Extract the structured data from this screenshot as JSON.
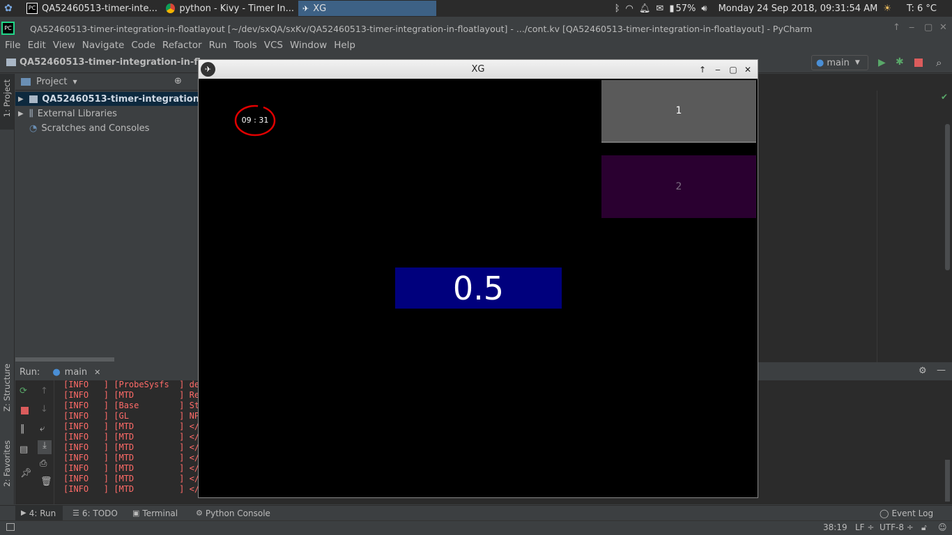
{
  "taskbar": {
    "tasks": [
      {
        "label": "QA52460513-timer-inte..."
      },
      {
        "label": "python - Kivy - Timer In..."
      },
      {
        "label": "XG"
      }
    ],
    "battery": "57%",
    "datetime": "Monday 24 Sep 2018, 09:31:54 AM",
    "weather": "T: 6 °C"
  },
  "ide": {
    "title": "QA52460513-timer-integration-in-floatlayout [~/dev/sxQA/sxKv/QA52460513-timer-integration-in-floatlayout] - .../cont.kv [QA52460513-timer-integration-in-floatlayout] - PyCharm",
    "menu": [
      "File",
      "Edit",
      "View",
      "Navigate",
      "Code",
      "Refactor",
      "Run",
      "Tools",
      "VCS",
      "Window",
      "Help"
    ],
    "breadcrumb": "QA52460513-timer-integration-in-fl",
    "run_config": "main",
    "left_tabs": {
      "project": "1: Project",
      "structure": "Z: Structure",
      "favorites": "2: Favorites"
    },
    "project_panel": {
      "header": "Project",
      "items": [
        {
          "label": "QA52460513-timer-integration"
        },
        {
          "label": "External Libraries"
        },
        {
          "label": "Scratches and Consoles"
        }
      ]
    },
    "run_panel": {
      "label": "Run:",
      "tab": "main",
      "log": [
        "[INFO   ] [ProbeSysfs  ] dev",
        "[INFO   ] [MTD         ] Rea",
        "[INFO   ] [Base        ] Sta",
        "[INFO   ] [GL          ] NPO",
        "[INFO   ] [MTD         ] </d",
        "[INFO   ] [MTD         ] </d",
        "[INFO   ] [MTD         ] </d",
        "[INFO   ] [MTD         ] </d",
        "[INFO   ] [MTD         ] </d",
        "[INFO   ] [MTD         ] </d",
        "[INFO   ] [MTD         ] </d"
      ]
    },
    "bottom_tabs": [
      {
        "label": "4: Run"
      },
      {
        "label": "6: TODO"
      },
      {
        "label": "Terminal"
      },
      {
        "label": "Python Console"
      }
    ],
    "event_log": "Event Log",
    "status": {
      "position": "38:19",
      "line_sep": "LF ÷",
      "encoding": "UTF-8 ÷"
    }
  },
  "kivy_window": {
    "title": "XG",
    "clock": "09 : 31",
    "button1": "1",
    "button2": "2",
    "value": "0.5"
  }
}
